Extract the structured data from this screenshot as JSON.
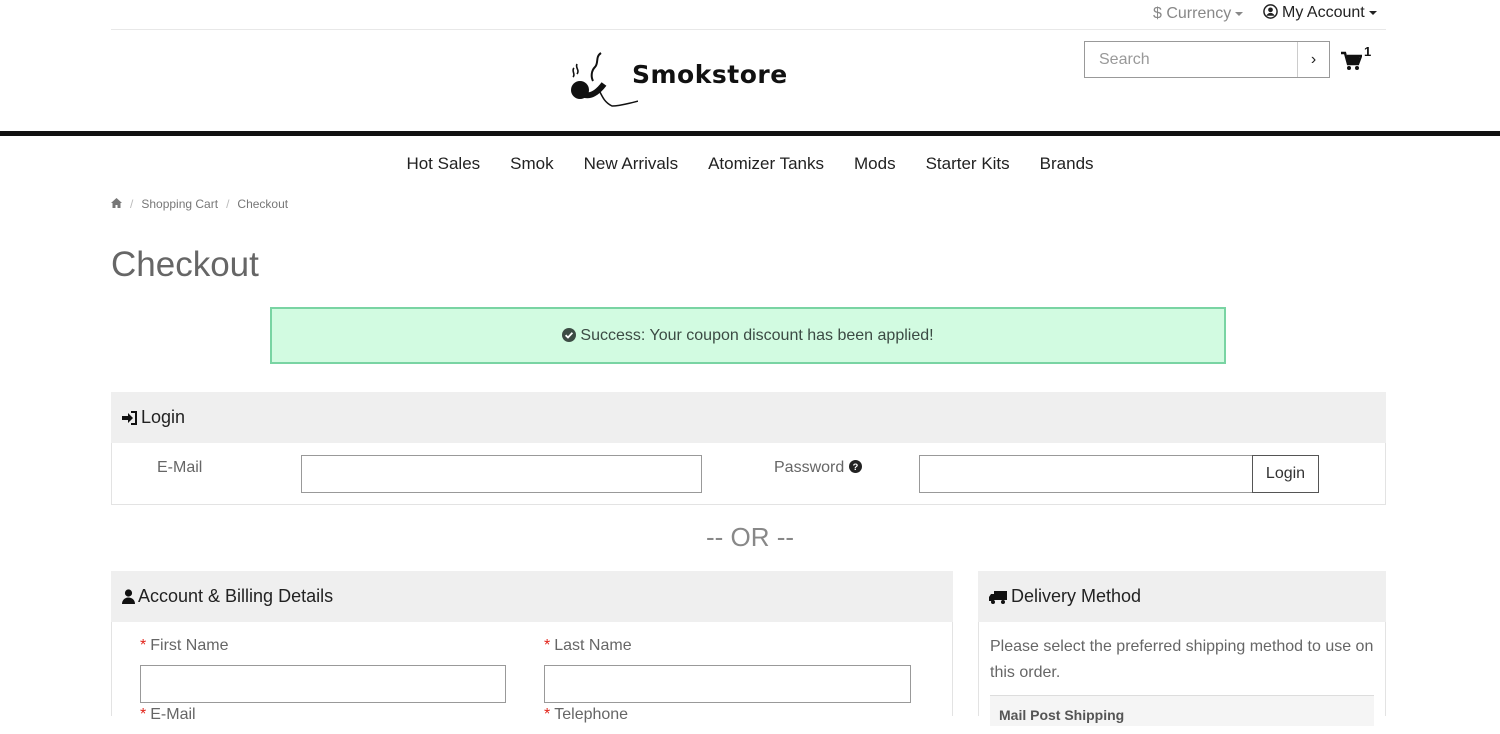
{
  "topbar": {
    "currency_label": "$ Currency",
    "account_label": "My Account"
  },
  "header": {
    "logo_text": "Smokstore",
    "search_placeholder": "Search",
    "search_button": "›",
    "cart_count": "1"
  },
  "nav": {
    "items": [
      "Hot Sales",
      "Smok",
      "New Arrivals",
      "Atomizer Tanks",
      "Mods",
      "Starter Kits",
      "Brands"
    ]
  },
  "breadcrumb": {
    "items": [
      "Shopping Cart",
      "Checkout"
    ],
    "separator": "/"
  },
  "page": {
    "title": "Checkout"
  },
  "alert": {
    "message": "Success: Your coupon discount has been applied!"
  },
  "login": {
    "heading": "Login",
    "email_label": "E-Mail",
    "password_label": "Password",
    "button_label": "Login",
    "email_value": "",
    "password_value": ""
  },
  "or_divider": "-- OR --",
  "account": {
    "heading": "Account & Billing Details",
    "first_name_label": "First Name",
    "last_name_label": "Last Name",
    "email_label": "E-Mail",
    "telephone_label": "Telephone",
    "required_mark": "*"
  },
  "delivery": {
    "heading": "Delivery Method",
    "description": "Please select the preferred shipping method to use on this order.",
    "option_group": "Mail Post Shipping"
  },
  "colors": {
    "alert_bg": "#d2fbe1",
    "alert_border": "#79d4a3",
    "required": "#e2231a",
    "panel_bg": "#efefef",
    "divider": "#111111"
  },
  "icons": [
    "user-circle-icon",
    "caret-down-icon",
    "cart-icon",
    "home-icon",
    "check-circle-icon",
    "sign-in-icon",
    "question-circle-icon",
    "user-icon",
    "truck-icon"
  ]
}
